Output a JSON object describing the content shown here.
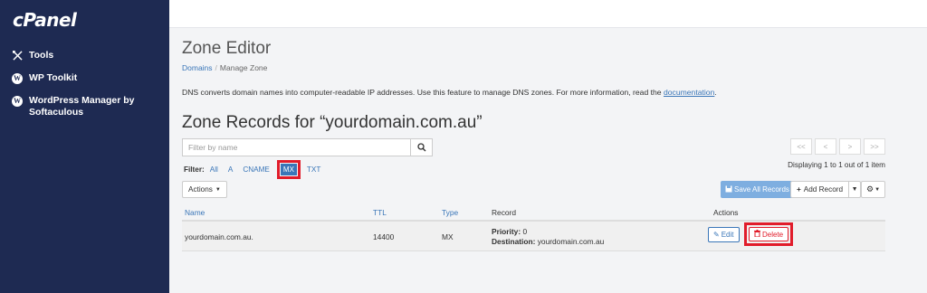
{
  "sidebar": {
    "logo": "cPanel",
    "items": [
      {
        "label": "Tools",
        "icon": "tools-icon"
      },
      {
        "label": "WP Toolkit",
        "icon": "wordpress-icon"
      },
      {
        "label": "WordPress Manager by Softaculous",
        "icon": "wordpress-icon"
      }
    ]
  },
  "header": {
    "title": "Zone Editor",
    "breadcrumb": [
      "Domains",
      "Manage Zone"
    ]
  },
  "description": {
    "text": "DNS converts domain names into computer-readable IP addresses. Use this feature to manage DNS zones. For more information, read the ",
    "link": "documentation",
    "end": "."
  },
  "zone": {
    "heading": "Zone Records for “yourdomain.com.au”",
    "search_placeholder": "Filter by name",
    "filter_label": "Filter:",
    "filters": [
      "All",
      "A",
      "CNAME",
      "MX",
      "TXT"
    ],
    "active_filter": "MX",
    "pager": [
      "<<",
      "<",
      ">",
      ">>"
    ],
    "displaying": "Displaying 1 to 1 out of 1 item"
  },
  "toolbar": {
    "actions_label": "Actions",
    "save_all_label": "Save All Records",
    "add_record_label": "Add Record"
  },
  "table": {
    "columns": [
      "Name",
      "TTL",
      "Type",
      "Record",
      "Actions"
    ],
    "rows": [
      {
        "name": "yourdomain.com.au.",
        "ttl": "14400",
        "type": "MX",
        "priority_label": "Priority:",
        "priority": "0",
        "destination_label": "Destination:",
        "destination": "yourdomain.com.au",
        "edit_label": "Edit",
        "delete_label": "Delete"
      }
    ]
  },
  "colors": {
    "sidebar_bg": "#1e2a52",
    "link": "#3a76b8",
    "highlight": "#e11c2a"
  }
}
